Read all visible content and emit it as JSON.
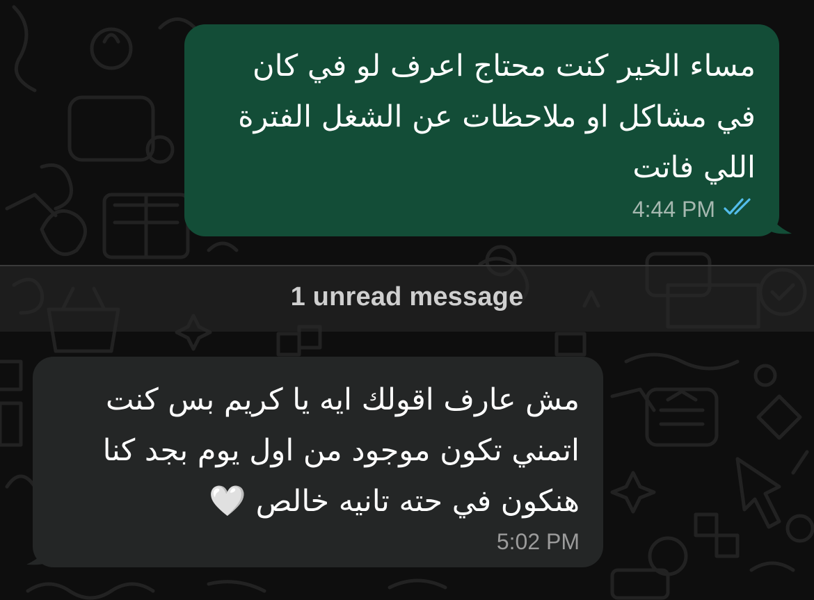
{
  "conversation": {
    "outgoing": {
      "text": "مساء الخير كنت محتاج اعرف لو في كان في مشاكل او ملاحظات عن الشغل الفترة اللي فاتت",
      "time": "4:44 PM",
      "status": "read",
      "status_icon": "double-check-icon",
      "bubble_color": "#134d37",
      "check_color": "#53bdeb"
    },
    "unread_divider": {
      "label": "1 unread message"
    },
    "incoming": {
      "text": "مش عارف اقولك ايه يا كريم بس كنت اتمني تكون موجود من اول يوم بجد كنا هنكون في حته تانيه خالص 🤍",
      "time": "5:02 PM",
      "bubble_color": "#242626"
    }
  }
}
